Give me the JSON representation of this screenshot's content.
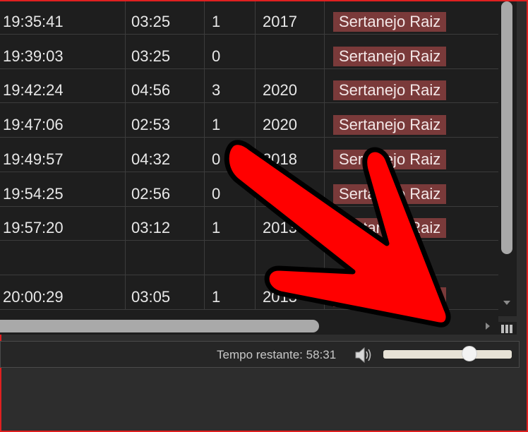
{
  "playlist": {
    "rows": [
      {
        "time": "19:35:41",
        "duration": "03:25",
        "count": "1",
        "year": "2017",
        "genre": "Sertanejo Raiz"
      },
      {
        "time": "19:39:03",
        "duration": "03:25",
        "count": "0",
        "year": "",
        "genre": "Sertanejo Raiz"
      },
      {
        "time": "19:42:24",
        "duration": "04:56",
        "count": "3",
        "year": "2020",
        "genre": "Sertanejo Raiz"
      },
      {
        "time": "19:47:06",
        "duration": "02:53",
        "count": "1",
        "year": "2020",
        "genre": "Sertanejo Raiz"
      },
      {
        "time": "19:49:57",
        "duration": "04:32",
        "count": "0",
        "year": "2018",
        "genre": "Sertanejo Raiz"
      },
      {
        "time": "19:54:25",
        "duration": "02:56",
        "count": "0",
        "year": "",
        "genre": "Sertanejo Raiz"
      },
      {
        "time": "19:57:20",
        "duration": "03:12",
        "count": "1",
        "year": "2013",
        "genre": "Sertanejo Raiz"
      },
      {
        "time": "",
        "duration": "",
        "count": "",
        "year": "",
        "genre": ""
      },
      {
        "time": "20:00:29",
        "duration": "03:05",
        "count": "1",
        "year": "2013",
        "genre": "Sertanejo Raiz"
      }
    ]
  },
  "status": {
    "remaining_text": "Tempo restante: 58:31",
    "volume": 0.67
  },
  "scroll": {
    "vertical_position": 0.0,
    "horizontal_position": 0.0
  },
  "colors": {
    "annotation_arrow": "#ff0000",
    "genre_badge": "#7a3a3a",
    "frame_border": "#e02020"
  },
  "icons": {
    "speaker": "speaker-icon",
    "grip": "resize-grip-icon"
  }
}
